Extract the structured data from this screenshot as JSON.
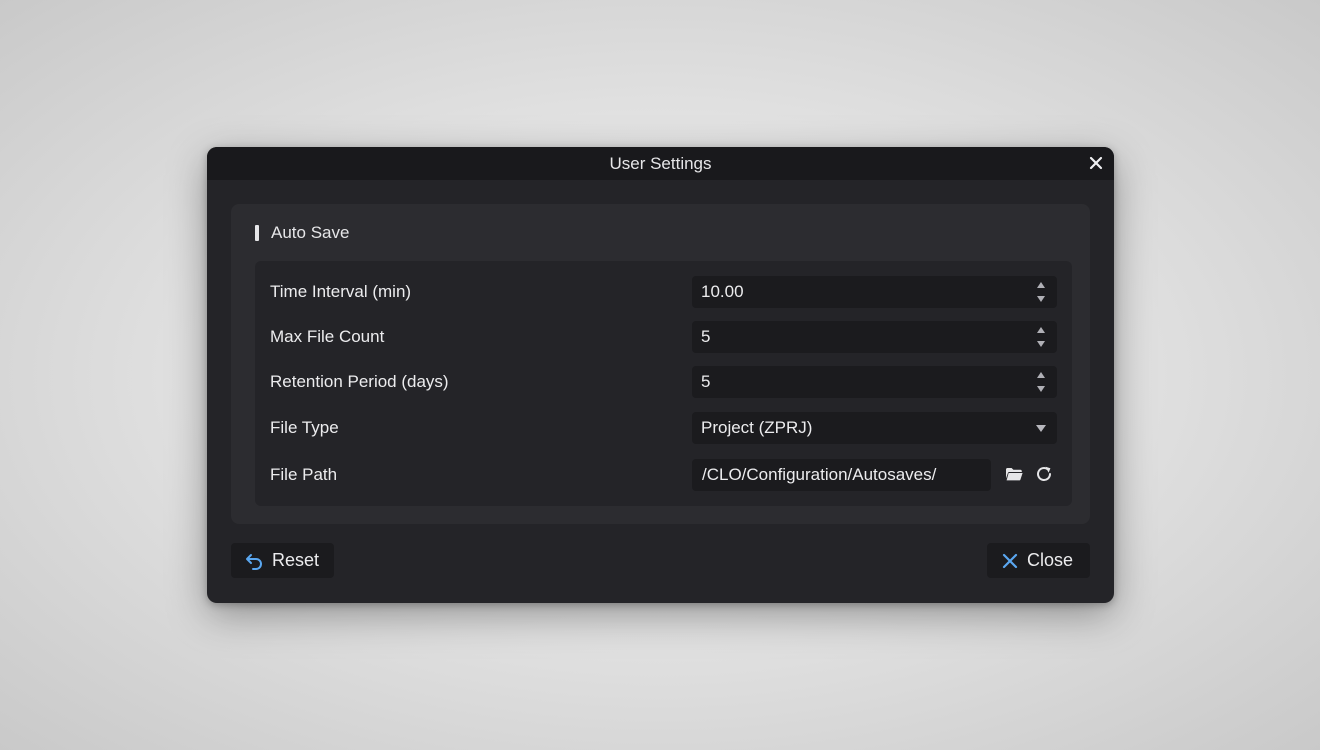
{
  "dialog": {
    "title": "User Settings",
    "close_icon": "close-icon"
  },
  "section": {
    "title": "Auto Save",
    "fields": [
      {
        "label": "Time Interval (min)",
        "value": "10.00",
        "control": "spinbox"
      },
      {
        "label": "Max File Count",
        "value": "5",
        "control": "spinbox"
      },
      {
        "label": "Retention Period (days)",
        "value": "5",
        "control": "spinbox"
      },
      {
        "label": "File Type",
        "value": "Project (ZPRJ)",
        "control": "dropdown"
      },
      {
        "label": "File Path",
        "value": "/CLO/Configuration/Autosaves/",
        "control": "path"
      }
    ],
    "path_icons": [
      "folder-icon",
      "refresh-icon"
    ]
  },
  "footer": {
    "reset_label": "Reset",
    "close_label": "Close"
  },
  "colors": {
    "accent": "#5aa7f0",
    "dialog_bg": "#242428",
    "titlebar_bg": "#19191c",
    "section_bg": "#2c2c30",
    "input_bg": "#1b1b1e"
  }
}
